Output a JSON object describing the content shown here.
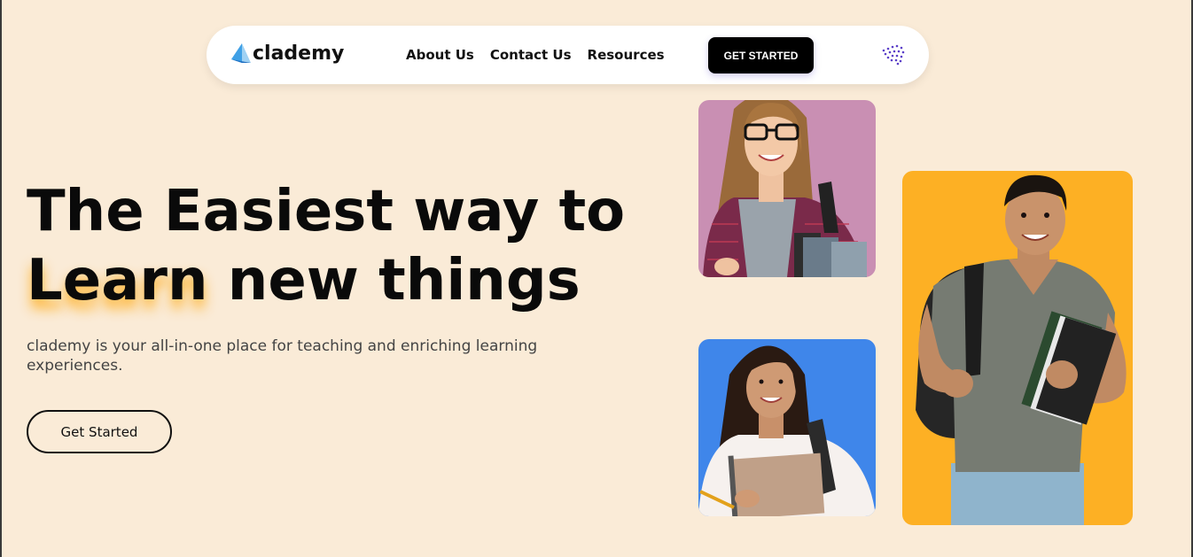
{
  "nav": {
    "logo_text": "clademy",
    "links": [
      {
        "label": "About Us"
      },
      {
        "label": "Contact Us"
      },
      {
        "label": "Resources"
      }
    ],
    "cta_label": "GET STARTED"
  },
  "hero": {
    "title_line1": "The Easiest way to",
    "title_highlight": "Learn",
    "title_line2_rest": " new things",
    "subtitle": "clademy is your all-in-one place for teaching and enriching learning experiences.",
    "button_label": "Get Started"
  },
  "colors": {
    "background": "#faebd7",
    "card_pink": "#c98fb3",
    "card_blue": "#3f86ea",
    "card_yellow": "#fdb024",
    "accent_glow": "#ffaa14"
  },
  "icons": [
    "logo-icon",
    "dots-menu-icon"
  ]
}
